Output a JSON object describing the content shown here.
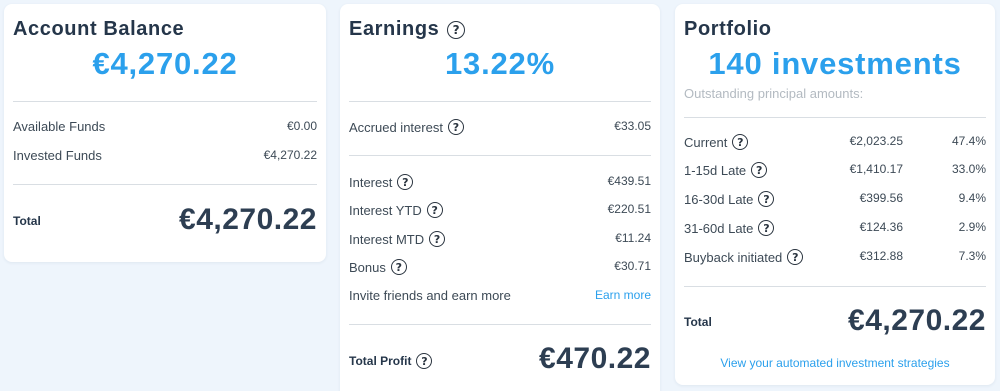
{
  "balance": {
    "title": "Account Balance",
    "amount": "€4,270.22",
    "rows": [
      {
        "label": "Available Funds",
        "value": "€0.00"
      },
      {
        "label": "Invested Funds",
        "value": "€4,270.22"
      }
    ],
    "total_label": "Total",
    "total_value": "€4,270.22"
  },
  "earnings": {
    "title": "Earnings",
    "rate": "13.22%",
    "accrued": {
      "label": "Accrued interest",
      "value": "€33.05"
    },
    "rows": [
      {
        "label": "Interest",
        "value": "€439.51"
      },
      {
        "label": "Interest YTD",
        "value": "€220.51"
      },
      {
        "label": "Interest MTD",
        "value": "€11.24"
      },
      {
        "label": "Bonus",
        "value": "€30.71"
      }
    ],
    "invite": {
      "label": "Invite friends and earn more",
      "link": "Earn more"
    },
    "total_label": "Total Profit",
    "total_value": "€470.22"
  },
  "portfolio": {
    "title": "Portfolio",
    "count": "140 investments",
    "note": "Outstanding principal amounts:",
    "rows": [
      {
        "label": "Current",
        "amount": "€2,023.25",
        "pct": "47.4%"
      },
      {
        "label": "1-15d Late",
        "amount": "€1,410.17",
        "pct": "33.0%"
      },
      {
        "label": "16-30d Late",
        "amount": "€399.56",
        "pct": "9.4%"
      },
      {
        "label": "31-60d Late",
        "amount": "€124.36",
        "pct": "2.9%"
      },
      {
        "label": "Buyback initiated",
        "amount": "€312.88",
        "pct": "7.3%"
      }
    ],
    "total_label": "Total",
    "total_value": "€4,270.22",
    "footer_link": "View your automated investment strategies"
  },
  "icons": {
    "help": "question-circle-icon"
  },
  "colors": {
    "accent": "#2ba0ec",
    "heading": "#25364a",
    "background": "#eef5fc"
  }
}
